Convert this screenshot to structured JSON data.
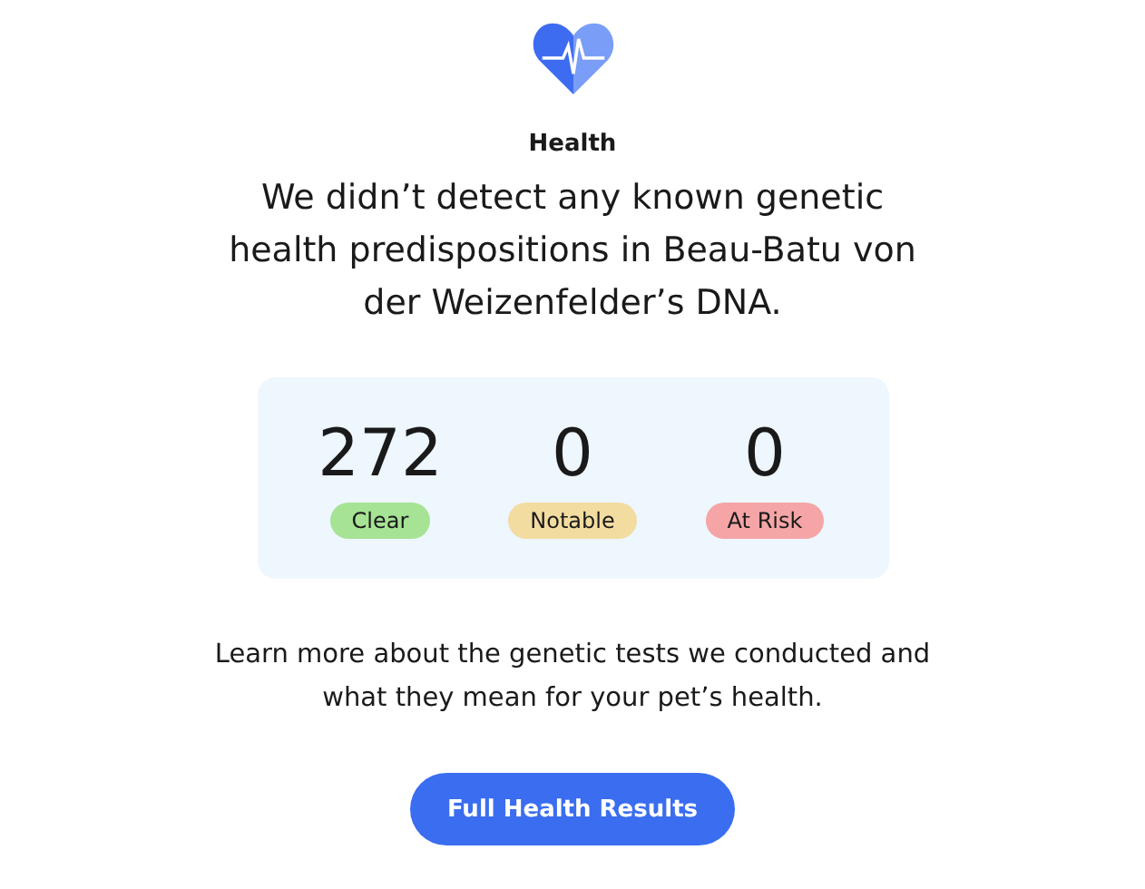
{
  "section": {
    "title": "Health"
  },
  "headline": "We didn’t detect any known genetic health predispositions in Beau-Batu von der Weizenfelder’s DNA.",
  "stats": [
    {
      "value": "272",
      "label": "Clear",
      "color": "#a6e395"
    },
    {
      "value": "0",
      "label": "Notable",
      "color": "#f2dca0"
    },
    {
      "value": "0",
      "label": "At Risk",
      "color": "#f5a5a6"
    }
  ],
  "description": "Learn more about the genetic tests we conducted and what they mean for your pet’s health.",
  "button": "Full Health Results"
}
